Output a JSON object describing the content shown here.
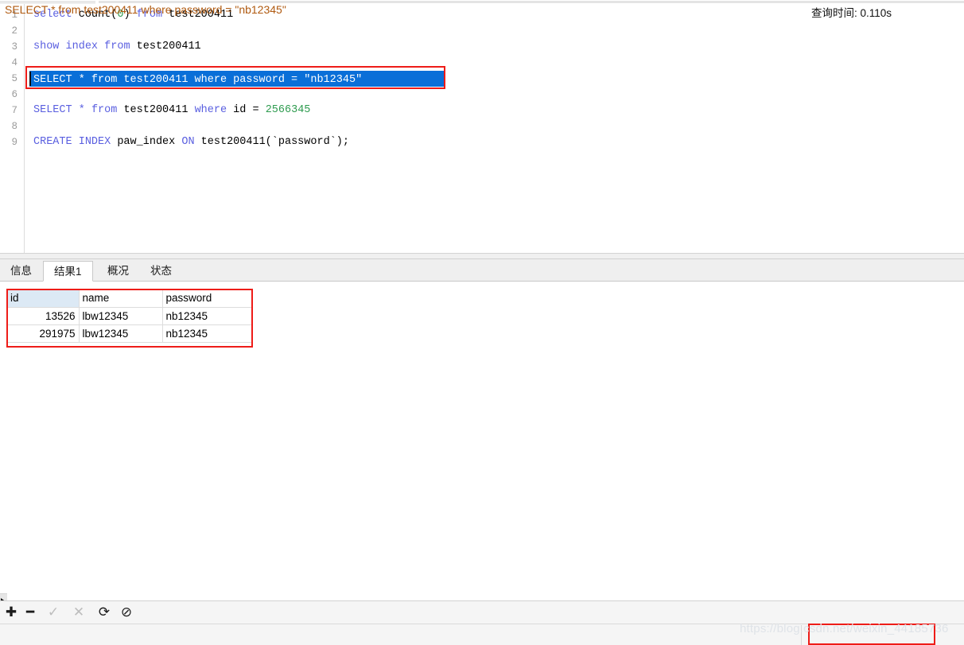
{
  "editor": {
    "lines": [
      {
        "num": "1",
        "tokens": [
          {
            "t": "select",
            "c": "kw"
          },
          {
            "t": " ",
            "c": "plain"
          },
          {
            "t": "count",
            "c": "plain"
          },
          {
            "t": "(",
            "c": "plain"
          },
          {
            "t": "0",
            "c": "num"
          },
          {
            "t": ") ",
            "c": "plain"
          },
          {
            "t": "from",
            "c": "kw"
          },
          {
            "t": " test200411",
            "c": "plain"
          }
        ]
      },
      {
        "num": "2",
        "tokens": []
      },
      {
        "num": "3",
        "tokens": [
          {
            "t": "show",
            "c": "kw"
          },
          {
            "t": " ",
            "c": "plain"
          },
          {
            "t": "index",
            "c": "kw"
          },
          {
            "t": " ",
            "c": "plain"
          },
          {
            "t": "from",
            "c": "kw"
          },
          {
            "t": " test200411",
            "c": "plain"
          }
        ]
      },
      {
        "num": "4",
        "tokens": []
      },
      {
        "num": "5",
        "selected": true,
        "text": "SELECT * from test200411 where password = \"nb12345\"",
        "tokens": [
          {
            "t": "SELECT * from test200411 where password = \"nb12345\"",
            "c": "plain"
          }
        ]
      },
      {
        "num": "6",
        "tokens": []
      },
      {
        "num": "7",
        "tokens": [
          {
            "t": "SELECT",
            "c": "kw"
          },
          {
            "t": " ",
            "c": "plain"
          },
          {
            "t": "*",
            "c": "kw"
          },
          {
            "t": " ",
            "c": "plain"
          },
          {
            "t": "from",
            "c": "kw"
          },
          {
            "t": " test200411 ",
            "c": "plain"
          },
          {
            "t": "where",
            "c": "kw"
          },
          {
            "t": " id = ",
            "c": "plain"
          },
          {
            "t": "2566345",
            "c": "num"
          }
        ]
      },
      {
        "num": "8",
        "tokens": []
      },
      {
        "num": "9",
        "tokens": [
          {
            "t": "CREATE",
            "c": "kw"
          },
          {
            "t": " ",
            "c": "plain"
          },
          {
            "t": "INDEX",
            "c": "kw"
          },
          {
            "t": " paw_index ",
            "c": "plain"
          },
          {
            "t": "ON",
            "c": "kw"
          },
          {
            "t": " test200411(`password`);",
            "c": "plain"
          }
        ]
      }
    ]
  },
  "result_tabs": [
    {
      "label": "信息",
      "active": false
    },
    {
      "label": "结果1",
      "active": true
    },
    {
      "label": "概况",
      "active": false
    },
    {
      "label": "状态",
      "active": false
    }
  ],
  "result_grid": {
    "columns": [
      "id",
      "name",
      "password"
    ],
    "selected_column": "id",
    "rows": [
      {
        "id": "13526",
        "name": "lbw12345",
        "password": "nb12345",
        "current": true
      },
      {
        "id": "291975",
        "name": "lbw12345",
        "password": "nb12345",
        "current": false
      }
    ]
  },
  "toolbar": {
    "buttons": [
      {
        "name": "add-record-button",
        "glyph": "✚",
        "enabled": true
      },
      {
        "name": "delete-record-button",
        "glyph": "━",
        "enabled": true
      },
      {
        "name": "apply-changes-button",
        "glyph": "✓",
        "enabled": false
      },
      {
        "name": "cancel-changes-button",
        "glyph": "✕",
        "enabled": false
      },
      {
        "name": "refresh-button",
        "glyph": "⟳",
        "enabled": true
      },
      {
        "name": "stop-button",
        "glyph": "⊘",
        "enabled": true
      }
    ]
  },
  "status": {
    "sql": "SELECT * from test200411 where password = \"nb12345\"",
    "query_time": "查询时间: 0.110s"
  },
  "watermark": "https://blog.csdn.net/weixin_44185736",
  "colors": {
    "keyword": "#5a5fe0",
    "number": "#2e9b4f",
    "selection": "#0a6fd8",
    "annotation_red": "#ee1c18",
    "status_sql": "#b05a10",
    "selected_header": "#dce9f5"
  }
}
